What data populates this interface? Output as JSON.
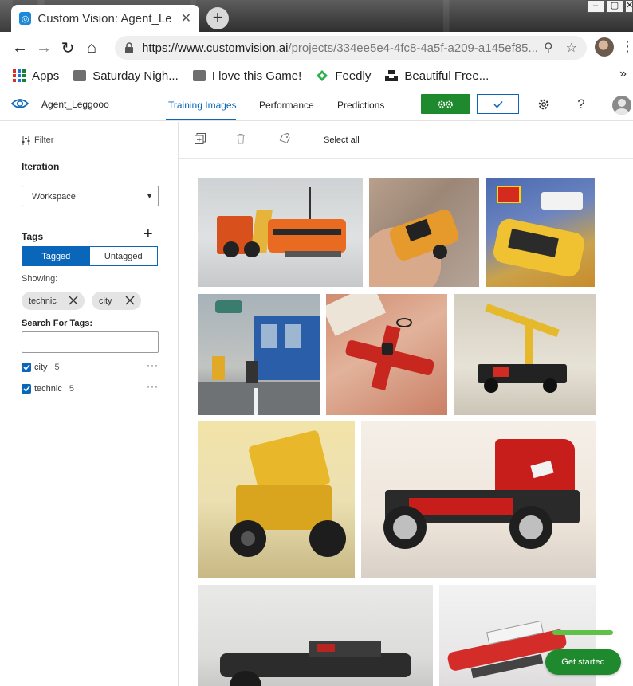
{
  "browser": {
    "tab_title": "Custom Vision: Agent_Le",
    "url_domain": "https://www.customvision.ai",
    "url_path": "/projects/334ee5e4-4fc8-4a5f-a209-a145ef85...",
    "bookmarks": [
      {
        "label": "Apps"
      },
      {
        "label": "Saturday Nigh..."
      },
      {
        "label": "I love this Game!"
      },
      {
        "label": "Feedly"
      },
      {
        "label": "Beautiful Free..."
      }
    ]
  },
  "header": {
    "project_name": "Agent_Leggooo",
    "tabs": [
      {
        "label": "Training Images",
        "active": true
      },
      {
        "label": "Performance",
        "active": false
      },
      {
        "label": "Predictions",
        "active": false
      }
    ],
    "colors": {
      "accent": "#0a66b8",
      "train": "#1e8a2d"
    }
  },
  "sidebar": {
    "filter_label": "Filter",
    "iteration_label": "Iteration",
    "iteration_value": "Workspace",
    "tags_label": "Tags",
    "tagged_label": "Tagged",
    "untagged_label": "Untagged",
    "showing_label": "Showing:",
    "showing_tags": [
      "technic",
      "city"
    ],
    "search_label": "Search For Tags:",
    "search_placeholder": "",
    "tags": [
      {
        "name": "city",
        "count": "5",
        "checked": true
      },
      {
        "name": "technic",
        "count": "5",
        "checked": true
      }
    ]
  },
  "main": {
    "select_all_label": "Select all"
  },
  "get_started": {
    "label": "Get started"
  }
}
